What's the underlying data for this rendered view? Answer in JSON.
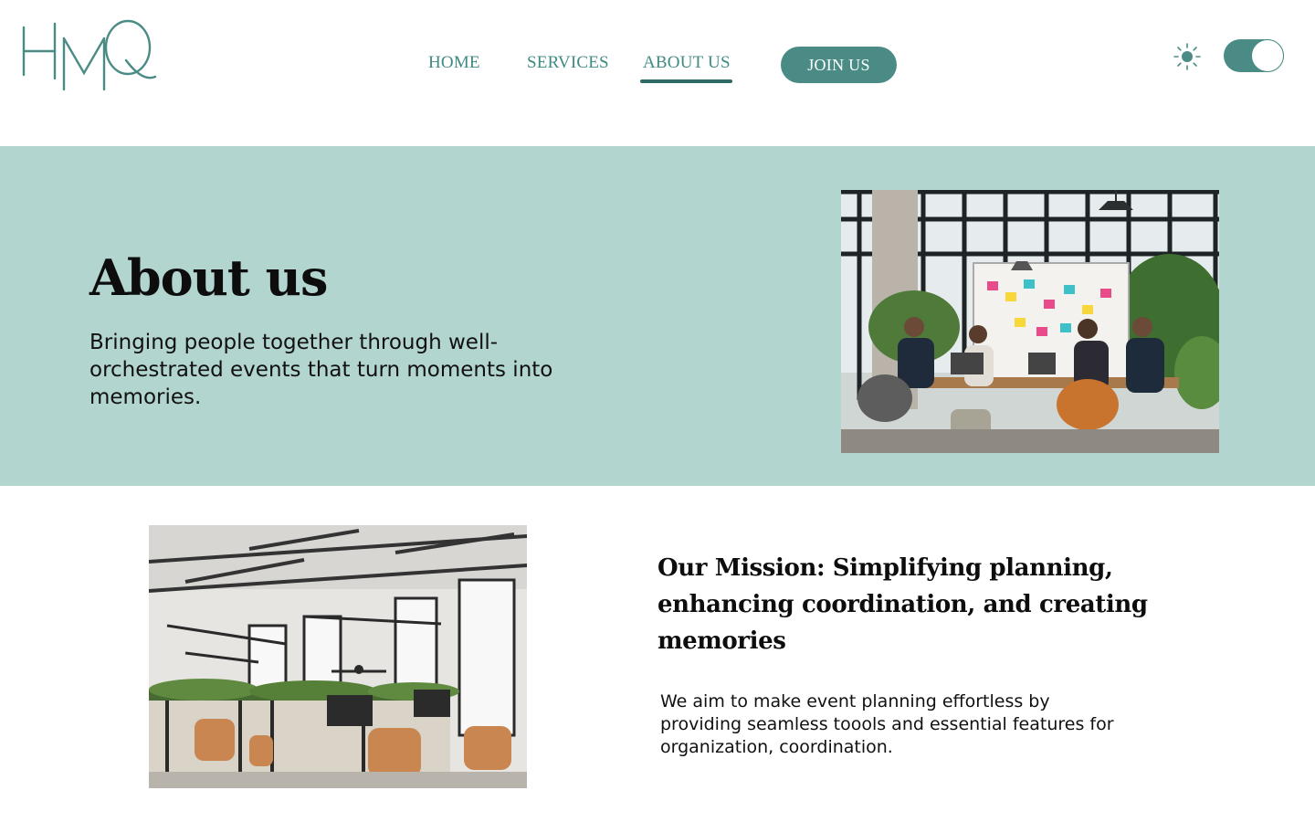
{
  "brand": {
    "logo_text": "HMQ",
    "accent": "#4a8c85",
    "hero_bg": "#b2d5cf",
    "nav_text": "#3f8a82"
  },
  "nav": {
    "items": [
      {
        "label": "HOME"
      },
      {
        "label": "SERVICES"
      },
      {
        "label": "ABOUT US",
        "active": true
      }
    ],
    "join_label": "JOIN US"
  },
  "theme": {
    "icon": "sun-icon",
    "toggle_on": true
  },
  "hero": {
    "title": "About us",
    "subtitle": "Bringing people together through well-orchestrated events that turn moments into memories.",
    "image_alt": "team-meeting-photo"
  },
  "mission": {
    "image_alt": "open-office-photo",
    "title": "Our Mission: Simplifying planning, enhancing coordination, and creating memories",
    "text": "We aim to make event planning effortless by providing seamless toools and essential features for organization, coordination."
  }
}
